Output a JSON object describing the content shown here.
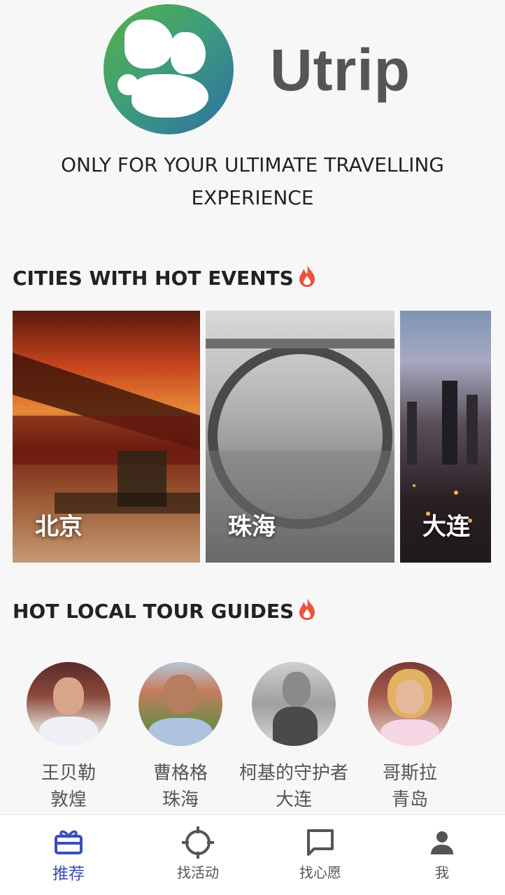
{
  "brand": {
    "name": "Utrip",
    "tagline": "ONLY FOR YOUR ULTIMATE TRAVELLING EXPERIENCE"
  },
  "sections": {
    "cities_title": "CITIES WITH HOT EVENTS",
    "guides_title": "HOT LOCAL TOUR GUIDES"
  },
  "cities": [
    {
      "name": "北京"
    },
    {
      "name": "珠海"
    },
    {
      "name": "大连"
    }
  ],
  "guides": [
    {
      "name": "王贝勒",
      "city": "敦煌"
    },
    {
      "name": "曹格格",
      "city": "珠海"
    },
    {
      "name": "柯基的守护者",
      "city": "大连"
    },
    {
      "name": "哥斯拉",
      "city": "青岛"
    }
  ],
  "tabs": [
    {
      "label": "推荐",
      "icon": "gift-icon",
      "active": true
    },
    {
      "label": "找活动",
      "icon": "crosshair-icon",
      "active": false
    },
    {
      "label": "找心愿",
      "icon": "chat-bubble-icon",
      "active": false
    },
    {
      "label": "我",
      "icon": "person-icon",
      "active": false
    }
  ],
  "colors": {
    "accent": "#3c4fb5",
    "fire": "#e8553f",
    "brand_text": "#555555"
  }
}
